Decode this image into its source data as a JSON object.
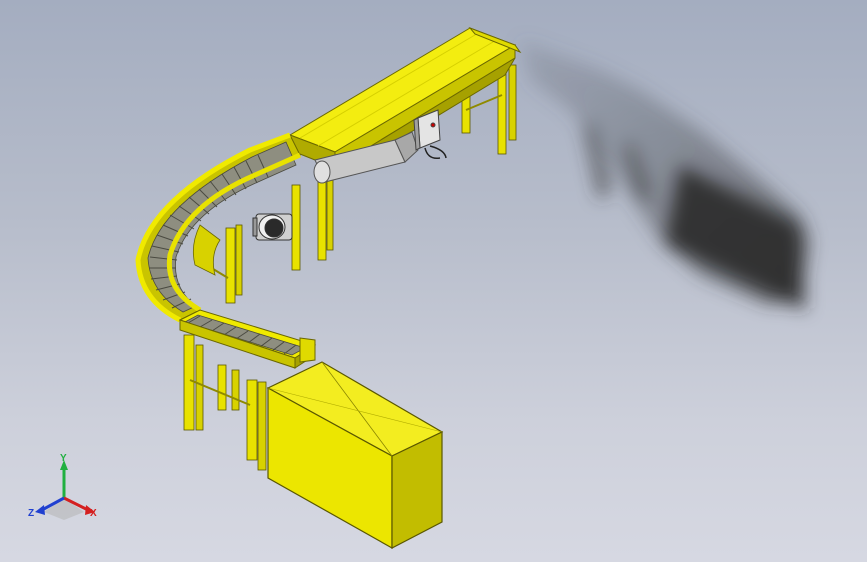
{
  "viewport": {
    "background_top": "#a4adc0",
    "background_bottom": "#d6d8e2",
    "model_color": "#f0ea00",
    "model_shade": "#c9c400",
    "model_dark": "#8f8a00",
    "roller_color": "#9a9a8a",
    "shadow_color": "#3a3a3a"
  },
  "triad": {
    "x_label": "X",
    "y_label": "Y",
    "z_label": "Z",
    "x_color": "#d42020",
    "y_color": "#20b040",
    "z_color": "#2040d0"
  },
  "model": {
    "components": [
      "straight-conveyor",
      "curved-roller-conveyor",
      "roller-conveyor",
      "drive-motor",
      "control-box",
      "box-load",
      "support-legs"
    ]
  }
}
